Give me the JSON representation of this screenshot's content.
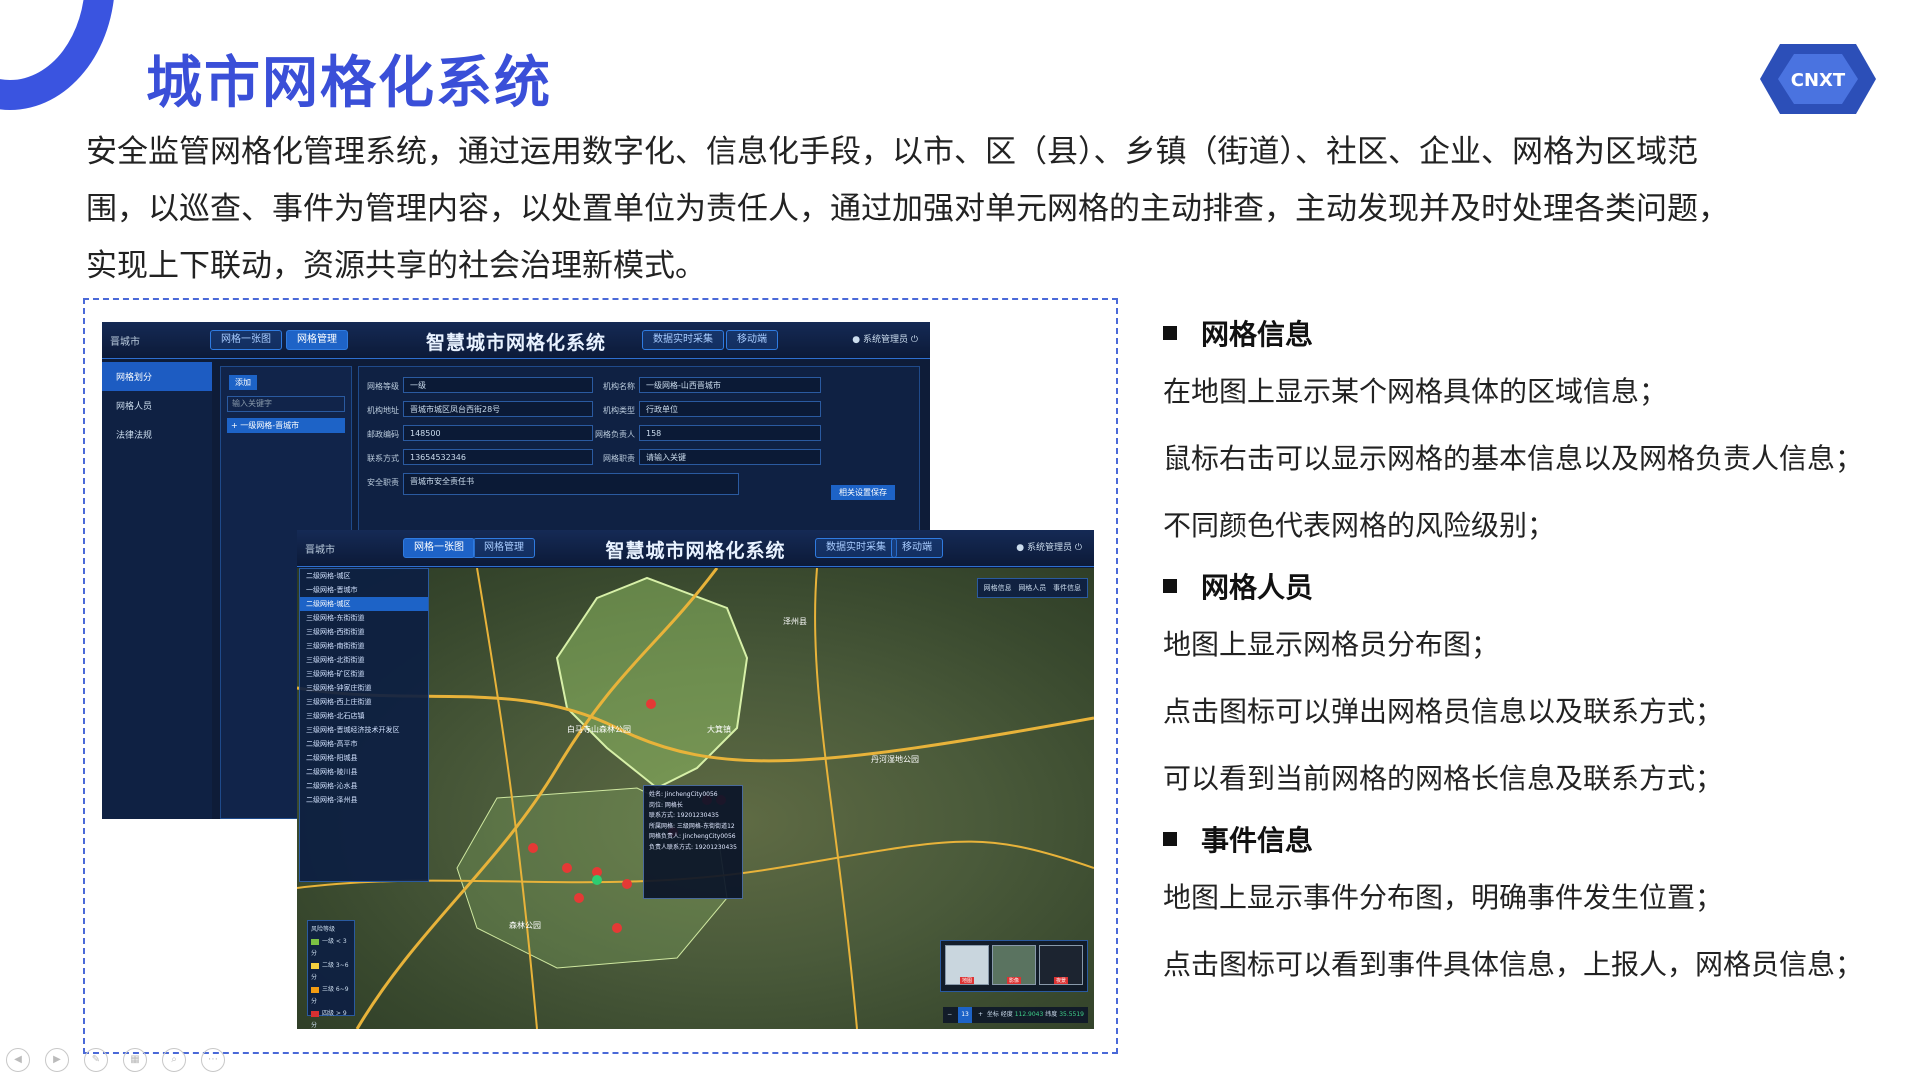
{
  "title": "城市网格化系统",
  "intro": "安全监管网格化管理系统，通过运用数字化、信息化手段，以市、区（县）、乡镇（街道）、社区、企业、网格为区域范围，以巡查、事件为管理内容，以处置单位为责任人，通过加强对单元网格的主动排查，主动发现并及时处理各类问题，实现上下联动，资源共享的社会治理新模式。",
  "logo_text": "CNXT",
  "screenshot1": {
    "app_title": "智慧城市网格化系统",
    "city_select": "晋城市",
    "header_buttons": [
      "网格一张图",
      "网格管理",
      "数据实时采集",
      "移动端"
    ],
    "user": "系统管理员",
    "nav": [
      "网格划分",
      "网格人员",
      "法律法规"
    ],
    "add_button": "添加",
    "search_placeholder": "输入关键字",
    "tree_node": "一级网格-晋城市",
    "form": {
      "labels": [
        "网格等级",
        "机构名称",
        "机构地址",
        "机构类型",
        "邮政编码",
        "网格负责人",
        "联系方式",
        "网格职责",
        "安全职责"
      ],
      "values": [
        "一级",
        "一级网格-山西晋城市",
        "晋城市城区凤台西街28号",
        "行政单位",
        "148500",
        "158",
        "13654532346",
        "请输入关键",
        "晋城市安全责任书"
      ],
      "save": "相关设置保存"
    }
  },
  "screenshot2": {
    "app_title": "智慧城市网格化系统",
    "city_select": "晋城市",
    "header_buttons": [
      "网格一张图",
      "网格管理",
      "数据实时采集",
      "移动端"
    ],
    "user": "系统管理员",
    "tree": [
      "二级网格-城区",
      "一级网格-晋城市",
      "二级网格-城区",
      "三级网格-东街街道",
      "三级网格-西街街道",
      "三级网格-南街街道",
      "三级网格-北街街道",
      "三级网格-矿区街道",
      "三级网格-钟家庄街道",
      "三级网格-西上庄街道",
      "三级网格-北石店镇",
      "三级网格-晋城经济技术开发区",
      "二级网格-高平市",
      "二级网格-阳城县",
      "二级网格-陵川县",
      "二级网格-沁水县",
      "二级网格-泽州县"
    ],
    "map_tools": [
      "网格信息",
      "网格人员",
      "事件信息"
    ],
    "popup": [
      "姓名: JinchengCity0056",
      "岗位: 网格长",
      "联系方式: 19201230435",
      "所属网格: 三级网格-东街街道12",
      "网格负责人: JinchengCity0056",
      "负责人联系方式: 19201230435"
    ],
    "legend_title": "风险等级",
    "legend": [
      {
        "label": "一级 < 3分",
        "color": "#7bc043"
      },
      {
        "label": "二级 3~6分",
        "color": "#f4d03f"
      },
      {
        "label": "三级 6~9分",
        "color": "#f39c12"
      },
      {
        "label": "四级 > 9分",
        "color": "#d63031"
      }
    ],
    "map_labels": [
      "白马寺山森林公园",
      "大箕镇",
      "泽州县",
      "森林公园",
      "丹河湿地公园"
    ],
    "thumb_labels": [
      "地图",
      "影像",
      "夜景"
    ],
    "zoom": "13",
    "coord_prefix": "坐标 经度",
    "coord_lng": "112.9043",
    "coord_lat_label": "纬度",
    "coord_lat": "35.5519"
  },
  "features": {
    "sections": [
      {
        "title": "网格信息",
        "lines": [
          "在地图上显示某个网格具体的区域信息；",
          "鼠标右击可以显示网格的基本信息以及网格负责人信息；",
          "不同颜色代表网格的风险级别；"
        ]
      },
      {
        "title": "网格人员",
        "lines": [
          "地图上显示网格员分布图；",
          "点击图标可以弹出网格员信息以及联系方式；",
          "可以看到当前网格的网格长信息及联系方式；"
        ]
      },
      {
        "title": "事件信息",
        "lines": [
          "地图上显示事件分布图，明确事件发生位置；",
          "点击图标可以看到事件具体信息，上报人，网格员信息；"
        ]
      }
    ]
  }
}
